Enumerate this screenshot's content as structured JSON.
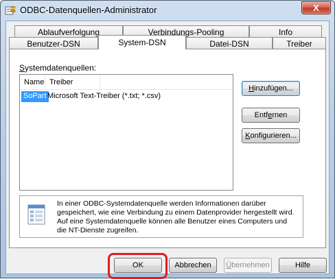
{
  "window": {
    "title": "ODBC-Datenquellen-Administrator",
    "close_label": "X"
  },
  "tabs_back": [
    "Ablaufverfolgung",
    "Verbindungs-Pooling",
    "Info"
  ],
  "tabs_front": [
    "Benutzer-DSN",
    "System-DSN",
    "Datei-DSN",
    "Treiber"
  ],
  "active_tab": "System-DSN",
  "panel": {
    "label_prefix": "S",
    "label_rest": "ystemdatenquellen:",
    "columns": [
      "Name",
      "Treiber"
    ],
    "rows": [
      {
        "name": "SoPart",
        "driver": "Microsoft Text-Treiber (*.txt; *.csv)"
      }
    ],
    "buttons": {
      "add": {
        "u": "H",
        "rest": "inzufügen..."
      },
      "remove_pre": "Entf",
      "remove_u": "e",
      "remove_post": "rnen",
      "configure": {
        "u": "K",
        "rest": "onfigurieren..."
      }
    },
    "info_lines": [
      "In einer ODBC-Systemdatenquelle werden Informationen darüber",
      "gespeichert, wie eine Verbindung zu einem Datenprovider hergestellt wird.",
      "Auf eine Systemdatenquelle können alle Benutzer eines Computers und",
      "die NT-Dienste zugreifen."
    ]
  },
  "footer": {
    "ok": "OK",
    "cancel": "Abbrechen",
    "apply_pre": "Ü",
    "apply_rest": "bernehmen",
    "help": "Hilfe"
  },
  "colors": {
    "selection": "#3399ff",
    "highlight_ring": "#e21c1c"
  }
}
